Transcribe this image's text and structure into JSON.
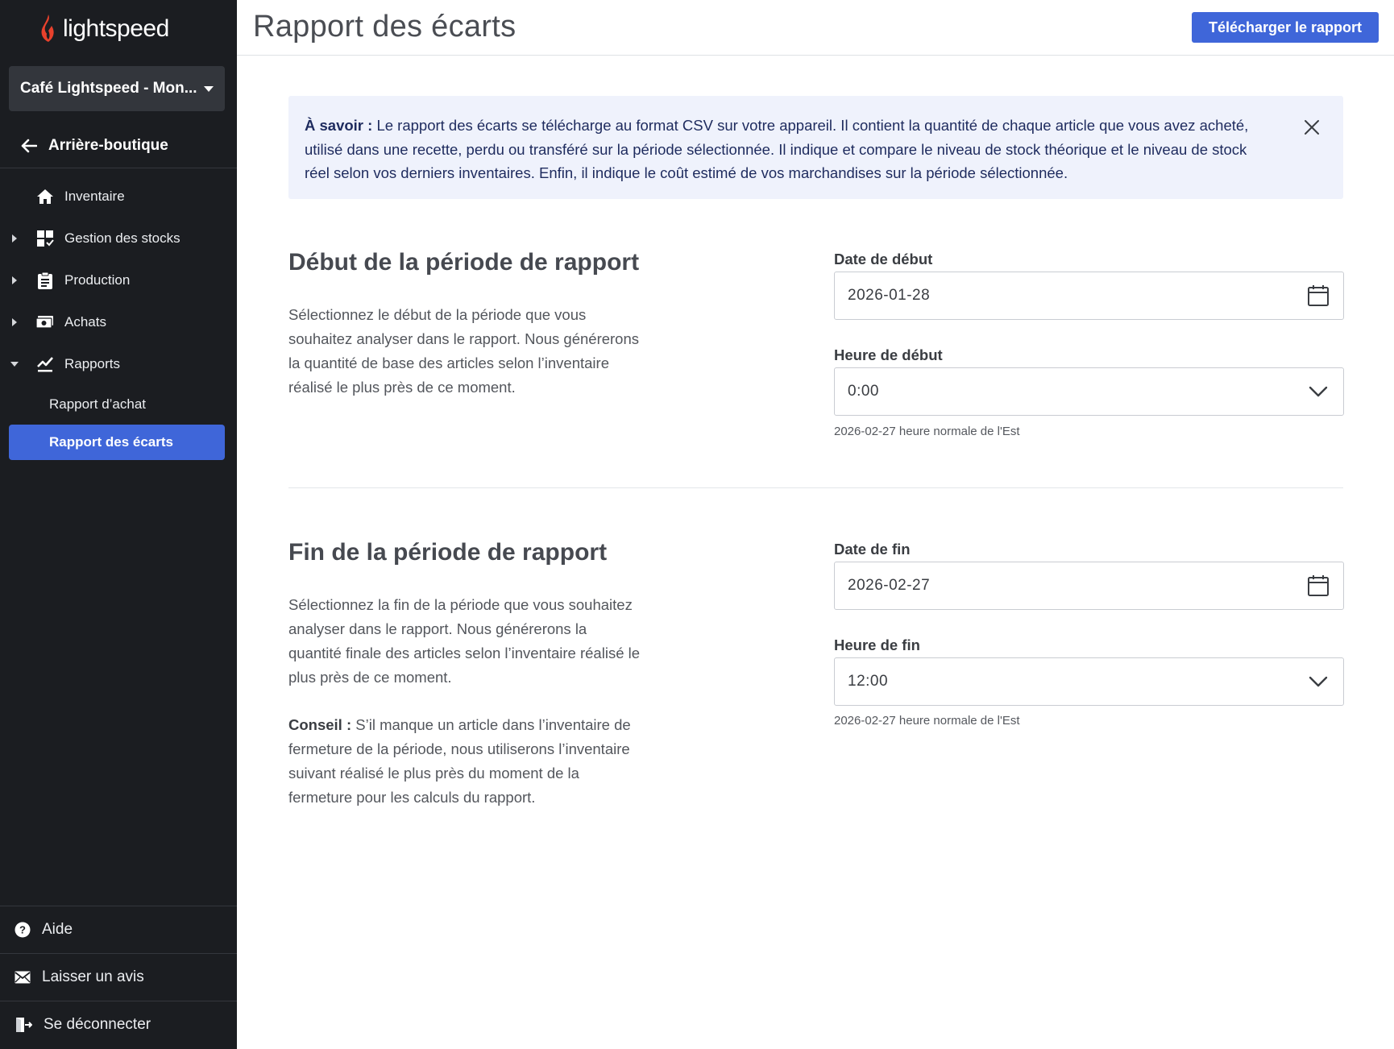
{
  "app": {
    "brand": "lightspeed",
    "brand_color": "#e8412c",
    "accent": "#3f66d9"
  },
  "sidebar": {
    "store_name": "Café Lightspeed - Mon...",
    "back_label": "Arrière-boutique",
    "items": [
      {
        "label": "Inventaire",
        "icon": "home-icon",
        "expandable": false
      },
      {
        "label": "Gestion des stocks",
        "icon": "dashboard-icon",
        "expandable": true,
        "expanded": false
      },
      {
        "label": "Production",
        "icon": "clipboard-icon",
        "expandable": true,
        "expanded": false
      },
      {
        "label": "Achats",
        "icon": "money-icon",
        "expandable": true,
        "expanded": false
      },
      {
        "label": "Rapports",
        "icon": "chart-icon",
        "expandable": true,
        "expanded": true
      }
    ],
    "subitems": [
      {
        "label": "Rapport d’achat",
        "active": false
      },
      {
        "label": "Rapport des écarts",
        "active": true
      }
    ],
    "bottom": {
      "help": "Aide",
      "feedback": "Laisser un avis",
      "logout": "Se déconnecter"
    }
  },
  "header": {
    "title": "Rapport des écarts",
    "download_label": "Télécharger le rapport"
  },
  "banner": {
    "lead": "À savoir :",
    "text": " Le rapport des écarts se télécharge au format CSV sur votre appareil. Il contient la quantité de chaque article que vous avez acheté, utilisé dans une recette, perdu ou transféré sur la période sélectionnée. Il indique et compare le niveau de stock théorique et le niveau de stock réel selon vos derniers inventaires. Enfin, il indique le coût estimé de vos marchandises sur la période sélectionnée."
  },
  "start": {
    "title": "Début de la période de rapport",
    "description": "Sélectionnez le début de la période que vous souhaitez analyser dans le rapport. Nous générerons la quantité de base des articles selon l’inventaire réalisé le plus près de ce moment.",
    "date_label": "Date de début",
    "date_value": "2026-01-28",
    "time_label": "Heure de début",
    "time_value": "0:00",
    "hint": "2026-02-27 heure normale de l'Est"
  },
  "end": {
    "title": "Fin de la période de rapport",
    "description": "Sélectionnez la fin de la période que vous souhaitez analyser dans le rapport. Nous générerons la quantité finale des articles selon l’inventaire réalisé le plus près de ce moment.",
    "tip_lead": "Conseil :",
    "tip_text": " S’il manque un article dans l’inventaire de fermeture de la période, nous utiliserons l’inventaire suivant réalisé le plus près du moment de la fermeture pour les calculs du rapport.",
    "date_label": "Date de fin",
    "date_value": "2026-02-27",
    "time_label": "Heure de fin",
    "time_value": "12:00",
    "hint": "2026-02-27 heure normale de l'Est"
  }
}
